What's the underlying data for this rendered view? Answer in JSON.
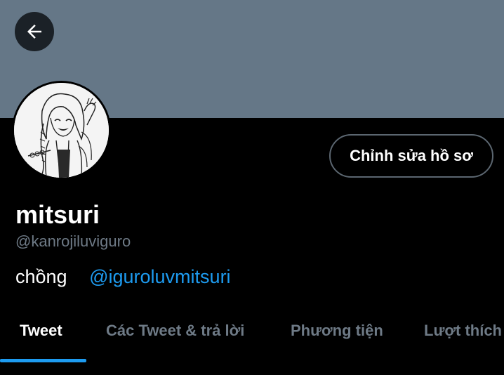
{
  "profile": {
    "display_name": "mitsuri",
    "handle": "@kanrojiluviguro",
    "bio_text": "chồng",
    "bio_mention": "@iguroluvmitsuri",
    "edit_button_label": "Chỉnh sửa hồ sơ"
  },
  "tabs": [
    {
      "label": "Tweet",
      "active": true
    },
    {
      "label": "Các Tweet & trả lời",
      "active": false
    },
    {
      "label": "Phương tiện",
      "active": false
    },
    {
      "label": "Lượt thích",
      "active": false
    }
  ],
  "colors": {
    "banner": "#657787",
    "background": "#000000",
    "accent": "#1d9bf0",
    "muted_text": "#6e7a86"
  },
  "icons": {
    "back": "arrow-left-icon"
  }
}
